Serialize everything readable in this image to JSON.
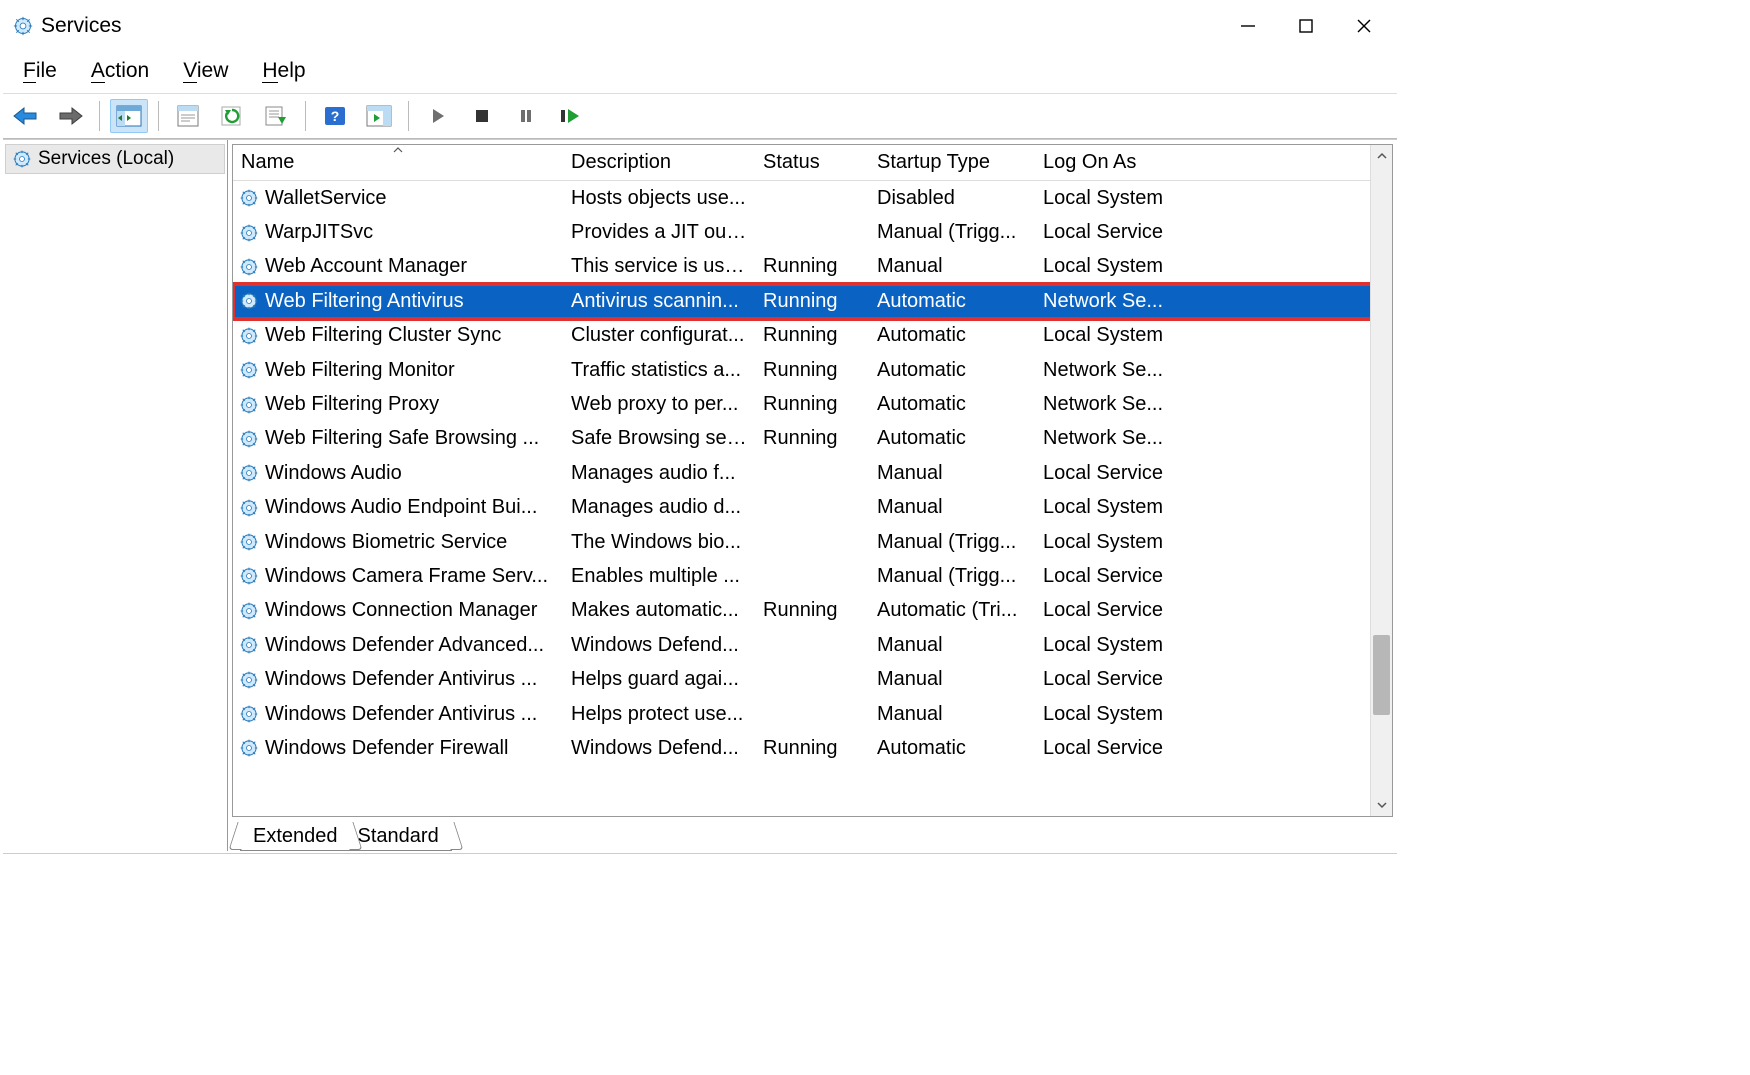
{
  "window": {
    "title": "Services"
  },
  "menu": {
    "file": "File",
    "action": "Action",
    "view": "View",
    "help": "Help"
  },
  "tree": {
    "root": "Services (Local)"
  },
  "columns": {
    "name": "Name",
    "description": "Description",
    "status": "Status",
    "startup": "Startup Type",
    "logon": "Log On As"
  },
  "tabs": {
    "extended": "Extended",
    "standard": "Standard"
  },
  "services": [
    {
      "name": "WalletService",
      "desc": "Hosts objects use...",
      "status": "",
      "startup": "Disabled",
      "logon": "Local System"
    },
    {
      "name": "WarpJITSvc",
      "desc": "Provides a JIT out...",
      "status": "",
      "startup": "Manual (Trigg...",
      "logon": "Local Service"
    },
    {
      "name": "Web Account Manager",
      "desc": "This service is use...",
      "status": "Running",
      "startup": "Manual",
      "logon": "Local System"
    },
    {
      "name": "Web Filtering Antivirus",
      "desc": "Antivirus scannin...",
      "status": "Running",
      "startup": "Automatic",
      "logon": "Network Se..."
    },
    {
      "name": "Web Filtering Cluster Sync",
      "desc": "Cluster configurat...",
      "status": "Running",
      "startup": "Automatic",
      "logon": "Local System"
    },
    {
      "name": "Web Filtering Monitor",
      "desc": "Traffic statistics a...",
      "status": "Running",
      "startup": "Automatic",
      "logon": "Network Se..."
    },
    {
      "name": "Web Filtering Proxy",
      "desc": "Web proxy to per...",
      "status": "Running",
      "startup": "Automatic",
      "logon": "Network Se..."
    },
    {
      "name": "Web Filtering Safe Browsing ...",
      "desc": "Safe Browsing ser...",
      "status": "Running",
      "startup": "Automatic",
      "logon": "Network Se..."
    },
    {
      "name": "Windows Audio",
      "desc": "Manages audio f...",
      "status": "",
      "startup": "Manual",
      "logon": "Local Service"
    },
    {
      "name": "Windows Audio Endpoint Bui...",
      "desc": "Manages audio d...",
      "status": "",
      "startup": "Manual",
      "logon": "Local System"
    },
    {
      "name": "Windows Biometric Service",
      "desc": "The Windows bio...",
      "status": "",
      "startup": "Manual (Trigg...",
      "logon": "Local System"
    },
    {
      "name": "Windows Camera Frame Serv...",
      "desc": "Enables multiple ...",
      "status": "",
      "startup": "Manual (Trigg...",
      "logon": "Local Service"
    },
    {
      "name": "Windows Connection Manager",
      "desc": "Makes automatic...",
      "status": "Running",
      "startup": "Automatic (Tri...",
      "logon": "Local Service"
    },
    {
      "name": "Windows Defender Advanced...",
      "desc": "Windows Defend...",
      "status": "",
      "startup": "Manual",
      "logon": "Local System"
    },
    {
      "name": "Windows Defender Antivirus ...",
      "desc": "Helps guard agai...",
      "status": "",
      "startup": "Manual",
      "logon": "Local Service"
    },
    {
      "name": "Windows Defender Antivirus ...",
      "desc": "Helps protect use...",
      "status": "",
      "startup": "Manual",
      "logon": "Local System"
    },
    {
      "name": "Windows Defender Firewall",
      "desc": "Windows Defend...",
      "status": "Running",
      "startup": "Automatic",
      "logon": "Local Service"
    }
  ],
  "selected_index": 3,
  "highlighted_index": 3
}
